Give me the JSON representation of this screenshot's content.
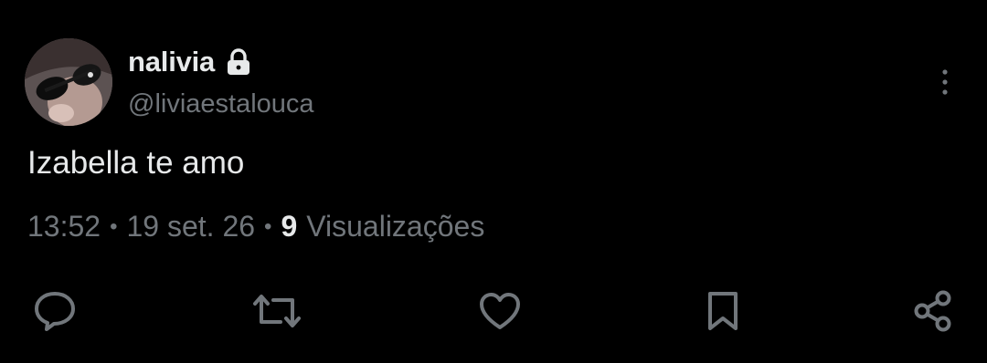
{
  "tweet": {
    "display_name": "nalivia",
    "handle": "@liviaestalouca",
    "text": "Izabella te amo",
    "time": "13:52",
    "separator": "•",
    "date": "19 set. 26",
    "views_count": "9",
    "views_label": "Visualizações"
  },
  "icons": {
    "lock": "lock-icon",
    "more": "more-vertical-icon",
    "reply": "reply-icon",
    "retweet": "retweet-icon",
    "like": "heart-icon",
    "bookmark": "bookmark-icon",
    "share": "share-icon"
  },
  "colors": {
    "background": "#000000",
    "primary_text": "#e7e9ea",
    "secondary_text": "#71767b"
  }
}
